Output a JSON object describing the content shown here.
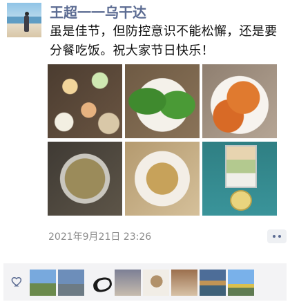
{
  "post": {
    "author": "王超一一乌干达",
    "text": "虽是佳节，但防控意识不能松懈，还是要分餐吃饭。祝大家节日快乐！",
    "timestamp": "2021年9月21日 23:26",
    "image_count": 6
  },
  "likes": {
    "icon": "heart-outline",
    "avatar_count": 8
  },
  "colors": {
    "name_blue": "#5b6b92",
    "text": "#111111",
    "time": "#8a8a8a",
    "likes_bg": "#f3f3f5"
  }
}
